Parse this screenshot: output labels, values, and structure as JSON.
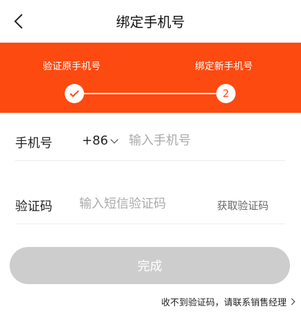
{
  "header": {
    "title": "绑定手机号",
    "back_icon": "chevron-left-icon"
  },
  "steps": {
    "step1_label": "验证原手机号",
    "step2_label": "绑定新手机号",
    "step1_icon": "check-icon",
    "step2_number": "2",
    "accent_color": "#fc4a10"
  },
  "form": {
    "phone_label": "手机号",
    "country_code": "+86",
    "phone_placeholder": "输入手机号",
    "phone_value": "",
    "code_label": "验证码",
    "code_placeholder": "输入短信验证码",
    "code_value": "",
    "get_code_label": "获取验证码"
  },
  "actions": {
    "done_label": "完成"
  },
  "footer": {
    "help_text": "收不到验证码，请联系销售经理"
  }
}
